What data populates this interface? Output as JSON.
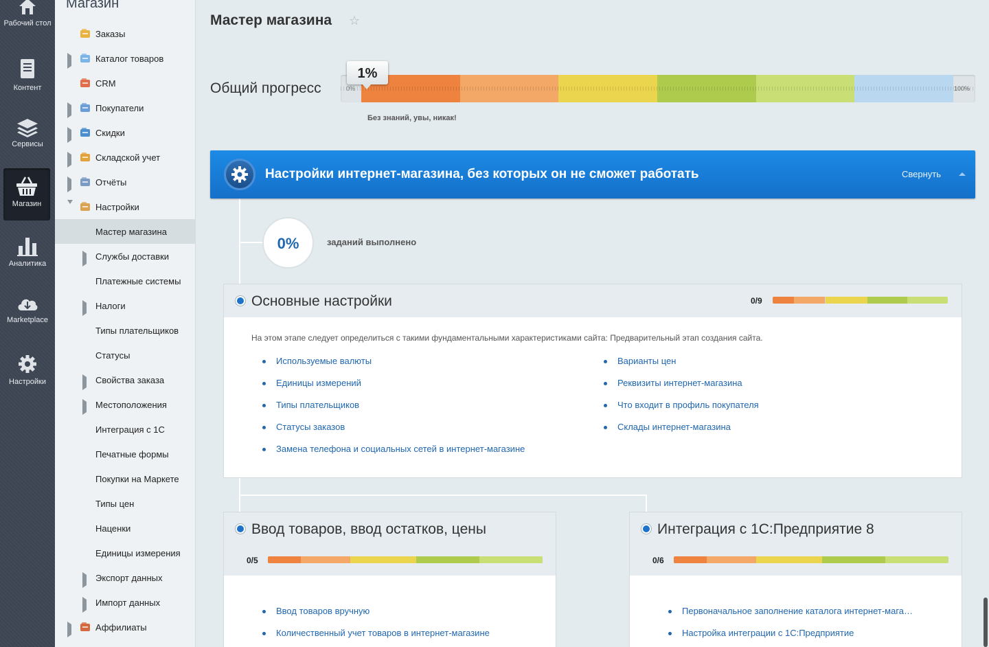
{
  "nav": {
    "items": [
      {
        "label": "Рабочий стол",
        "icon": "home-icon"
      },
      {
        "label": "Контент",
        "icon": "document-icon"
      },
      {
        "label": "Сервисы",
        "icon": "layers-icon"
      },
      {
        "label": "Магазин",
        "icon": "basket-icon",
        "active": true
      },
      {
        "label": "Аналитика",
        "icon": "bar-chart-icon"
      },
      {
        "label": "Marketplace",
        "icon": "cloud-download-icon"
      },
      {
        "label": "Настройки",
        "icon": "gear-icon"
      }
    ]
  },
  "sidebar": {
    "title": "Магазин",
    "items": [
      {
        "label": "Заказы",
        "level": 0,
        "marker": "dot",
        "icon": "orders-icon"
      },
      {
        "label": "Каталог товаров",
        "level": 0,
        "marker": "arrow",
        "icon": "folder-icon"
      },
      {
        "label": "CRM",
        "level": 0,
        "marker": "dot",
        "icon": "funnel-icon"
      },
      {
        "label": "Покупатели",
        "level": 0,
        "marker": "arrow",
        "icon": "users-icon"
      },
      {
        "label": "Скидки",
        "level": 0,
        "marker": "arrow",
        "icon": "percent-icon"
      },
      {
        "label": "Складской учет",
        "level": 0,
        "marker": "arrow",
        "icon": "warehouse-icon"
      },
      {
        "label": "Отчёты",
        "level": 0,
        "marker": "arrow",
        "icon": "report-icon"
      },
      {
        "label": "Настройки",
        "level": 0,
        "marker": "arrow-down",
        "icon": "settings-icon"
      },
      {
        "label": "Мастер магазина",
        "level": 1,
        "marker": "dot",
        "active": true
      },
      {
        "label": "Службы доставки",
        "level": 1,
        "marker": "arrow"
      },
      {
        "label": "Платежные системы",
        "level": 1,
        "marker": "dot"
      },
      {
        "label": "Налоги",
        "level": 1,
        "marker": "arrow"
      },
      {
        "label": "Типы плательщиков",
        "level": 1,
        "marker": "dot"
      },
      {
        "label": "Статусы",
        "level": 1,
        "marker": "dot"
      },
      {
        "label": "Свойства заказа",
        "level": 1,
        "marker": "arrow"
      },
      {
        "label": "Местоположения",
        "level": 1,
        "marker": "arrow"
      },
      {
        "label": "Интеграция с 1С",
        "level": 1,
        "marker": "dot"
      },
      {
        "label": "Печатные формы",
        "level": 1,
        "marker": "dot"
      },
      {
        "label": "Покупки на Маркете",
        "level": 1,
        "marker": "dot"
      },
      {
        "label": "Типы цен",
        "level": 1,
        "marker": "dot"
      },
      {
        "label": "Наценки",
        "level": 1,
        "marker": "dot"
      },
      {
        "label": "Единицы измерения",
        "level": 1,
        "marker": "dot"
      },
      {
        "label": "Экспорт данных",
        "level": 1,
        "marker": "arrow"
      },
      {
        "label": "Импорт данных",
        "level": 1,
        "marker": "arrow"
      },
      {
        "label": "Аффилиаты",
        "level": 0,
        "marker": "arrow",
        "icon": "affiliates-icon"
      }
    ]
  },
  "page": {
    "title": "Мастер магазина"
  },
  "progress": {
    "label": "Общий прогресс",
    "value": "1%",
    "fraction": 0.01,
    "min_label": "0%",
    "max_label": "100%",
    "caption": "Без знаний, увы, никак!",
    "colors": [
      "#ee8340",
      "#f4a867",
      "#ecd54e",
      "#aecb4e",
      "#c9de74",
      "#b9d8f0"
    ]
  },
  "banner": {
    "title": "Настройки интернет-магазина, без которых он не сможет работать",
    "collapse_label": "Свернуть",
    "icon": "gear-icon",
    "color": "#1a7edb"
  },
  "tasks": {
    "percent": "0%",
    "label": "заданий выполнено"
  },
  "sections": {
    "basic": {
      "title": "Основные настройки",
      "count": "0/9",
      "description": "На этом этапе следует определиться с такими фундаментальными характеристиками сайта: Предварительный этап создания сайта.",
      "links_left": [
        "Используемые валюты",
        "Единицы измерений",
        "Типы плательщиков",
        "Статусы заказов",
        "Замена телефона и социальных сетей в интернет-магазине"
      ],
      "links_right": [
        "Варианты цен",
        "Реквизиты интернет-магазина",
        "Что входит в профиль покупателя",
        "Склады интернет-магазина"
      ]
    },
    "goods": {
      "title": "Ввод товаров, ввод остатков, цены",
      "count": "0/5",
      "links": [
        "Ввод товаров вручную",
        "Количественный учет товаров в интернет-магазине"
      ]
    },
    "integration": {
      "title": "Интеграция с 1С:Предприятие 8",
      "count": "0/6",
      "links": [
        "Первоначальное заполнение каталога интернет-мага…",
        "Настройка интеграции с 1С:Предприятие"
      ]
    }
  }
}
